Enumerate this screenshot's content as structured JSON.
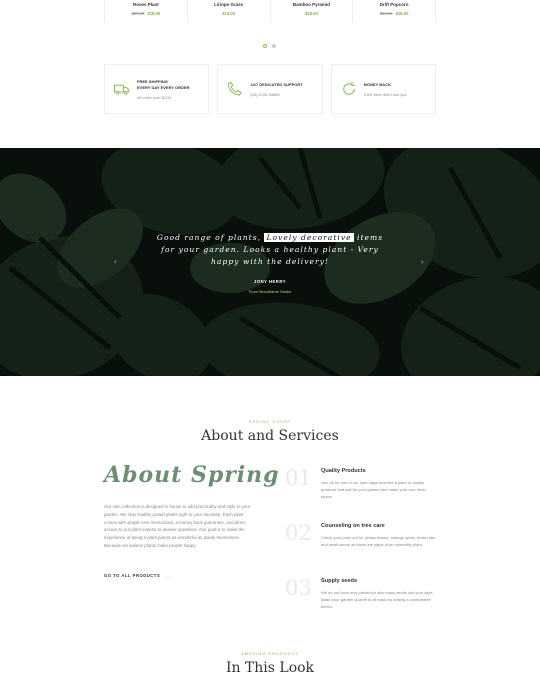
{
  "products": [
    {
      "name": "Roses Plant",
      "old_price": "$20.00",
      "price": "$18.00"
    },
    {
      "name": "Liriope Grass",
      "old_price": "",
      "price": "$19.00"
    },
    {
      "name": "Bamboo Pyramid",
      "old_price": "",
      "price": "$18.00"
    },
    {
      "name": "Drift Popcorn",
      "old_price": "$18.00",
      "price": "$16.00"
    }
  ],
  "features": [
    {
      "icon": "truck-icon",
      "title1": "FREE SHIPPING",
      "title2": "EVERY DAY EVERY ORDER",
      "sub": "All order over $100"
    },
    {
      "icon": "phone-icon",
      "title1": "24/7 DEDICATED SUPPORT",
      "title2": "",
      "sub": "(03) 4728 94884"
    },
    {
      "icon": "refresh-icon",
      "title1": "MONEY BACK",
      "title2": "",
      "sub": "If the item didn't suit you"
    }
  ],
  "testimonial": {
    "quote_before": "Good range of plants, ",
    "quote_highlight": "Lovely decorative",
    "quote_after": " items for your garden. Looks a healthy plant - Very happy with the delivery!",
    "author": "JONY HERRY",
    "role": "From Moonflame Studio",
    "prev": "‹",
    "next": "›"
  },
  "about": {
    "kicker": "SPRING STORE",
    "title": "About and Services",
    "heading": "About Spring",
    "text": "Our own collection is designed in house to add practicality and style to your garden. We ship healthy potted plants right to your doorstep. Each plant comes with simple care instructions, a money back guarantee, and direct access to our plant experts to answer questions. Our goal is to make the experience of being a plant parent as wonderful as plants themselves. Because we believe plants make people happy.",
    "link": "GO TO ALL PRODUCTS",
    "link_arrow": "→"
  },
  "services": [
    {
      "num": "01",
      "title": "Quality Products",
      "desc": "Join us for one of our open days and find a plant or quality products that suit for your garden and make your own fresh space."
    },
    {
      "num": "02",
      "title": "Counseling on tree care",
      "desc": "Check your plant out for yellow leaves, strange spots, brown tips and weak stems as these are signs of an unhealthy plant."
    },
    {
      "num": "03",
      "title": "Supply seeds",
      "desc": "We do not have only plants but also many seeds suit your style. Make your garden sizable to all basic by adding a comfortable bench."
    }
  ],
  "look": {
    "kicker": "AMAZING PRODUCTS",
    "title": "In This Look"
  }
}
